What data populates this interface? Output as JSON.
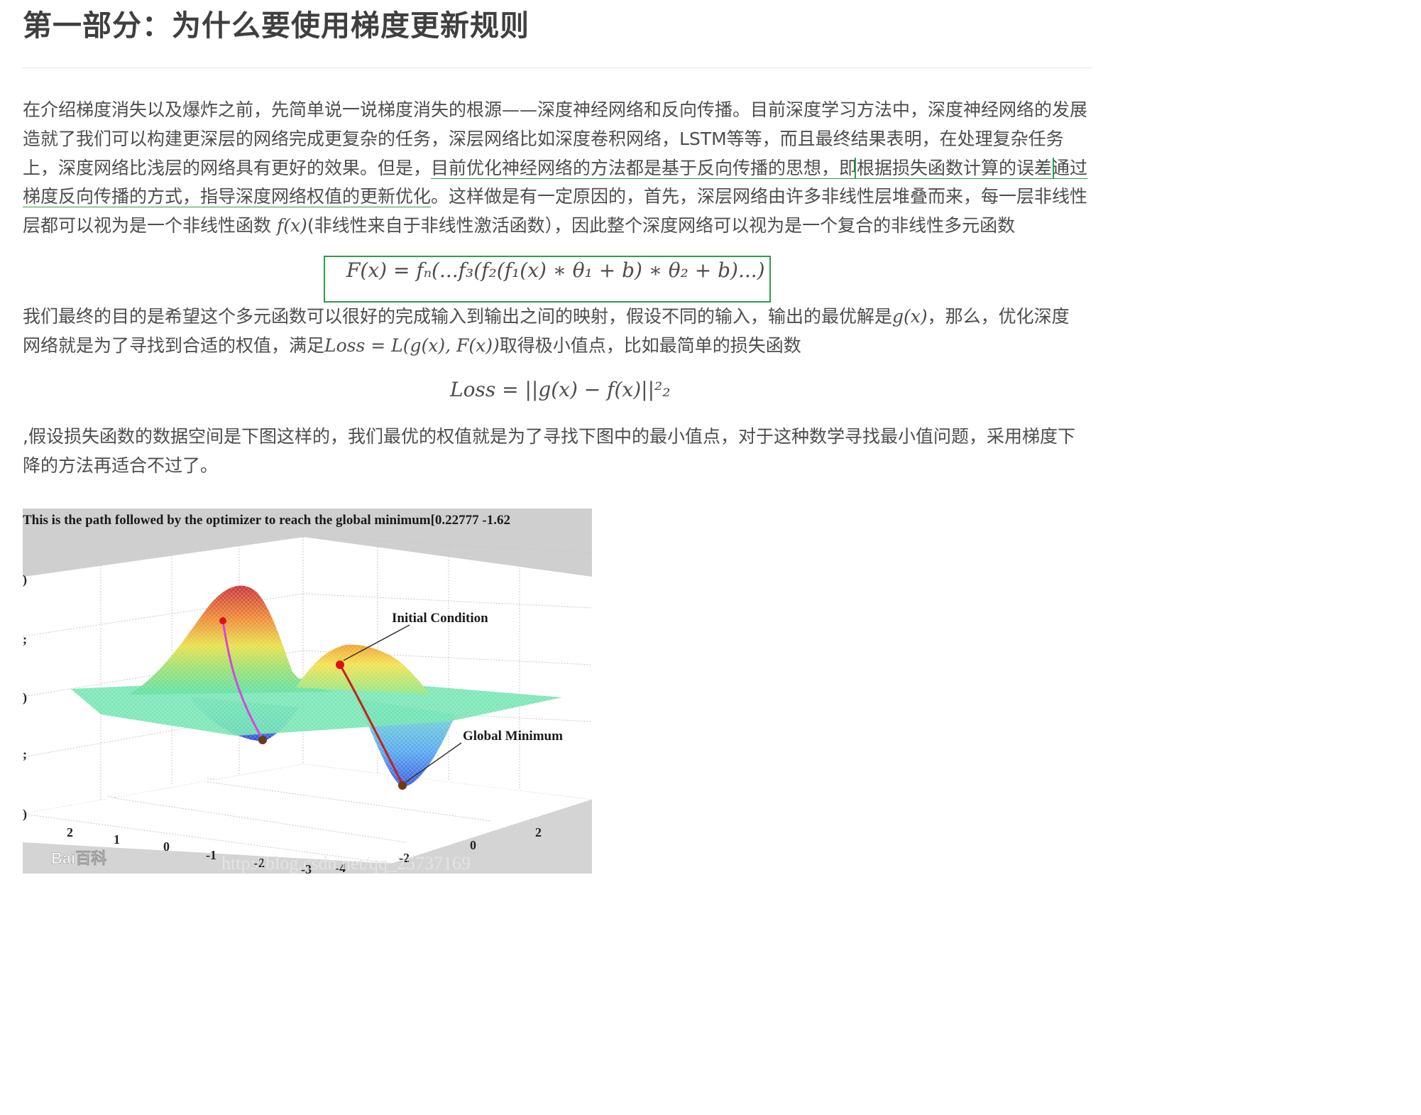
{
  "heading": "第一部分：为什么要使用梯度更新规则",
  "para1": {
    "l1": "在介绍梯度消失以及爆炸之前，先简单说一说梯度消失的根源——深度神经网络和反向传播。目前深度学习方法中，深度神经网络的发展",
    "l2": "造就了我们可以构建更深层的网络完成更复杂的任务，深层网络比如深度卷积网络，LSTM等等，而且最终结果表明，在处理复杂任务",
    "l3a": "上，深度网络比浅层的网络具有更好的效果。但是，",
    "l3b": "目前优化神经网络的方法都是基于反向传播的思想，即",
    "l3c": "根据损失函数计算的误差",
    "l3d": "通过",
    "l4a": "梯度反向传播的方式，指导深度网络权值的更新优化",
    "l4b": "。这样做是有一定原因的，首先，深层网络由许多非线性层堆叠而来，每一层非线性",
    "l5a": "层都可以视为是一个非线性函数 ",
    "l5math": "f(x)",
    "l5b": "(非线性来自于非线性激活函数），因此整个深度网络可以视为是一个复合的非线性多元函数"
  },
  "formula1": "F(x) = fₙ(...f₃(f₂(f₁(x) ∗ θ₁ + b) ∗ θ₂ + b)...)",
  "para2": {
    "l1a": "我们最终的目的是希望这个多元函数可以很好的完成输入到输出之间的映射，假设不同的输入，输出的最优解是",
    "l1math": "g(x)",
    "l1b": "，那么，优化深度",
    "l2a": "网络就是为了寻找到合适的权值，满足",
    "l2math": "Loss = L(g(x), F(x))",
    "l2b": "取得极小值点，比如最简单的损失函数"
  },
  "formula2": "Loss = ||g(x) − f(x)||²₂",
  "para3": {
    "l1": ",假设损失函数的数据空间是下图这样的，我们最优的权值就是为了寻找下图中的最小值点，对于这种数学寻找最小值问题，采用梯度下",
    "l2": "降的方法再适合不过了。"
  },
  "figure": {
    "title": "This is the path followed by the optimizer to reach the global minimum[0.22777     -1.62",
    "annotations": {
      "initial": "Initial Condition",
      "global": "Global Minimum"
    },
    "x_ticks": [
      "2",
      "1",
      "0",
      "-1",
      "-2",
      "-3"
    ],
    "y_ticks": [
      "2",
      "0",
      "-2",
      "-4"
    ],
    "watermark_logo": "Bai百科",
    "watermark_url": "http://blog.csdn.net/qq_25737169",
    "colors": {
      "surface_high": "#d23a2a",
      "surface_low": "#2b5bd8",
      "plane": "#5fe0a8",
      "path1": "#d04ad8",
      "path2": "#c8201c"
    }
  }
}
